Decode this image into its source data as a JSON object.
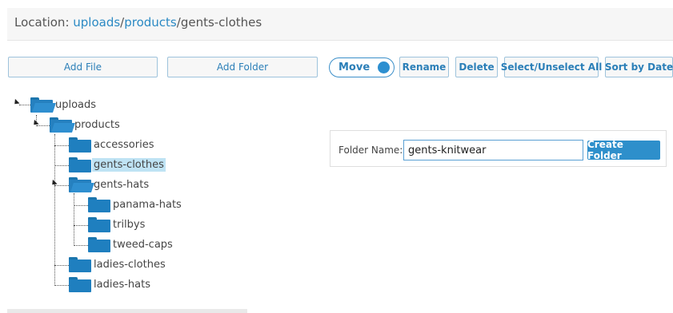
{
  "location": {
    "prefix": "Location: ",
    "crumb1": "uploads",
    "sep1": "/",
    "crumb2": "products",
    "sep2": "/",
    "current": "gents-clothes"
  },
  "toolbar": {
    "add_file": "Add File",
    "add_folder": "Add Folder",
    "move": "Move",
    "rename": "Rename",
    "delete": "Delete",
    "select_all": "Select/Unselect All",
    "sort": "Sort by Date"
  },
  "tree": {
    "uploads": "uploads",
    "products": "products",
    "accessories": "accessories",
    "gents_clothes": "gents-clothes",
    "gents_hats": "gents-hats",
    "panama_hats": "panama-hats",
    "trilbys": "trilbys",
    "tweed_caps": "tweed-caps",
    "ladies_clothes": "ladies-clothes",
    "ladies_hats": "ladies-hats"
  },
  "new_folder": {
    "label": "Folder Name:",
    "value": "gents-knitwear",
    "create": "Create Folder"
  }
}
